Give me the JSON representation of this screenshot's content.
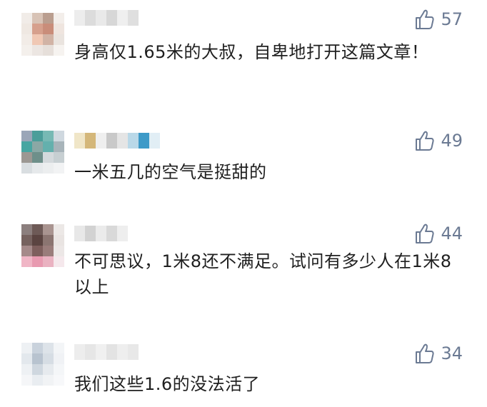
{
  "comments": [
    {
      "likes": "57",
      "text": "身高仅1.65米的大叔，自卑地打开这篇文章！",
      "avatar_colors": [
        "#f1ece8",
        "#d8c3b6",
        "#ba9e8f",
        "#f3eeea",
        "#efe8e2",
        "#d6a08d",
        "#c98d7a",
        "#efe5df",
        "#f2ece7",
        "#f0c8b4",
        "#d1b3a5",
        "#eae4df",
        "#f4f0ec",
        "#ece6e2",
        "#e6dfda",
        "#f6f3f0"
      ],
      "name_colors": [
        "#ededed",
        "#dcdcdc",
        "#e9e9e9",
        "#d7d7d7",
        "#efefef",
        "#dfdfdf"
      ]
    },
    {
      "likes": "49",
      "text": "一米五几的空气是挺甜的",
      "avatar_colors": [
        "#9aa6b8",
        "#4b9e9a",
        "#77b9b4",
        "#cfd8df",
        "#47a6a2",
        "#8aa8a5",
        "#64b0ad",
        "#a8b4ba",
        "#9c9893",
        "#6e8f8a",
        "#d4d9dc",
        "#c7cfd2",
        "#d9dee1",
        "#e6e9eb",
        "#eceeef",
        "#f2f3f4"
      ],
      "name_colors": [
        "#f0e6c8",
        "#d4b77a",
        "#efefef",
        "#c9c9c9",
        "#e5e5e5",
        "#b9d8e8",
        "#3d9ac8",
        "#e1eef5"
      ]
    },
    {
      "likes": "44",
      "text": "不可思议，1米8还不满足。试问有多少人在1米8以上",
      "avatar_colors": [
        "#8c7f7e",
        "#6e5a57",
        "#a99490",
        "#ece8e6",
        "#76625f",
        "#5b4441",
        "#8b7571",
        "#e9e4e2",
        "#a58a8a",
        "#7e5f5d",
        "#9a7d7b",
        "#ece7e6",
        "#f0b6c6",
        "#e89ab0",
        "#eab2c1",
        "#f5e8ec"
      ],
      "name_colors": [
        "#e8e8e8",
        "#d2d2d2",
        "#ebebeb",
        "#d9d9d9",
        "#eeeeee"
      ]
    },
    {
      "likes": "34",
      "text": "我们这些1.6的没法活了",
      "avatar_colors": [
        "#eef1f4",
        "#c9d2dc",
        "#dde3e9",
        "#f3f5f7",
        "#e3e8ed",
        "#b8c3cf",
        "#d6dde4",
        "#f0f2f5",
        "#eef1f4",
        "#cfd7df",
        "#e6eaee",
        "#f4f6f8",
        "#f5f6f8",
        "#e9edf1",
        "#f1f3f5",
        "#f7f8fa"
      ],
      "name_colors": [
        "#ededed",
        "#e6e6e6",
        "#f0f0f0",
        "#e3e3e3",
        "#eeeeee",
        "#e8e8e8"
      ]
    }
  ],
  "like_color": "#6b7a93",
  "icon": "thumbs-up-icon"
}
